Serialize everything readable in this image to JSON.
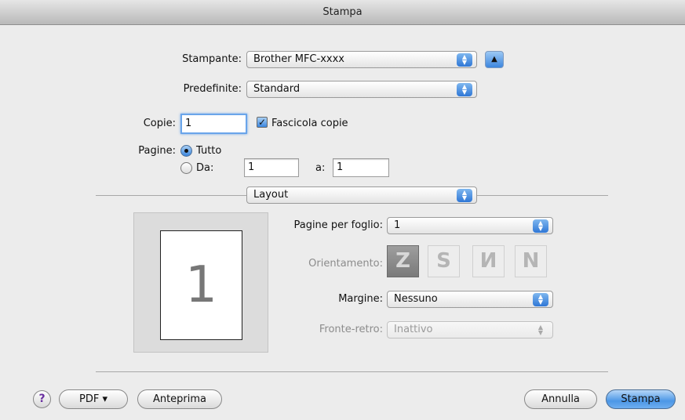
{
  "window": {
    "title": "Stampa"
  },
  "printer": {
    "label": "Stampante:",
    "value": "Brother MFC-xxxx"
  },
  "presets": {
    "label": "Predefinite:",
    "value": "Standard"
  },
  "copies": {
    "label": "Copie:",
    "value": "1",
    "collate_label": "Fascicola copie",
    "collate_checked": true
  },
  "pages": {
    "label": "Pagine:",
    "all_label": "Tutto",
    "from_label": "Da:",
    "from_value": "1",
    "to_label": "a:",
    "to_value": "1",
    "selected": "all"
  },
  "panel_select": {
    "value": "Layout"
  },
  "layout": {
    "preview_number": "1",
    "pages_per_sheet_label": "Pagine per foglio:",
    "pages_per_sheet_value": "1",
    "orientation_label": "Orientamento:",
    "orientation_icons": [
      "Z-icon",
      "S-icon",
      "reverse-N-icon",
      "N-icon"
    ],
    "orientation_glyphs": [
      "Z",
      "S",
      "И",
      "N"
    ],
    "border_label": "Margine:",
    "border_value": "Nessuno",
    "duplex_label": "Fronte-retro:",
    "duplex_value": "Inattivo"
  },
  "footer": {
    "help": "?",
    "pdf": "PDF ▾",
    "preview": "Anteprima",
    "cancel": "Annulla",
    "print": "Stampa"
  },
  "colors": {
    "accent": "#3d86de",
    "background": "#ececec"
  }
}
